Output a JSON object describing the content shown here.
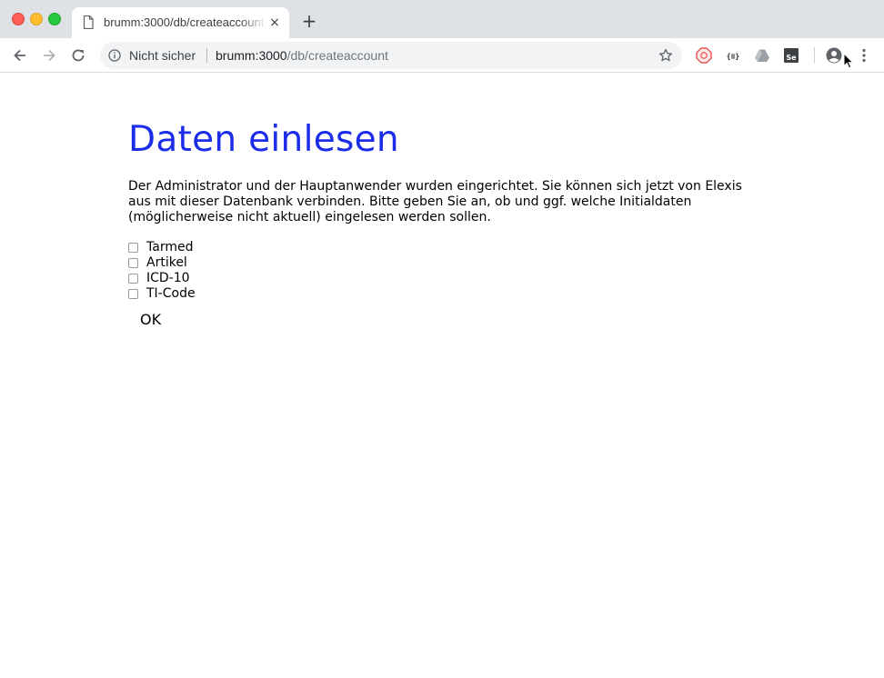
{
  "browser": {
    "tab_title": "brumm:3000/db/createaccount",
    "tab_close": "×",
    "new_tab": "+",
    "security_label": "Nicht sicher",
    "url_host": "brumm:3000",
    "url_path": "/db/createaccount",
    "icons": [
      "back-icon",
      "forward-icon",
      "reload-icon",
      "info-icon",
      "star-icon",
      "adblock-icon",
      "json-icon",
      "drive-icon",
      "selenium-icon",
      "profile-icon",
      "menu-icon"
    ]
  },
  "page": {
    "heading": "Daten einlesen",
    "intro": "Der Administrator und der Hauptanwender wurden eingerichtet. Sie können sich jetzt von Elexis aus mit dieser Datenbank verbinden. Bitte geben Sie an, ob und ggf. welche Initialdaten (möglicherweise nicht aktuell) eingelesen werden sollen.",
    "options": [
      "Tarmed",
      "Artikel",
      "ICD-10",
      "TI-Code"
    ],
    "ok_label": "OK",
    "heading_color": "#1b2de8"
  }
}
